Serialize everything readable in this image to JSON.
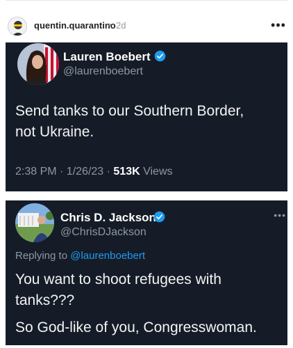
{
  "post": {
    "author": "quentin.quarantino",
    "separator": "•",
    "age": "2d",
    "more_menu": "•••"
  },
  "tweets": [
    {
      "display_name": "Lauren Boebert",
      "handle": "@laurenboebert",
      "text_lines": [
        "Send tanks to our Southern Border,",
        "not Ukraine."
      ],
      "time": "2:38 PM · 1/26/23 · ",
      "views_count": "513K",
      "views_label": " Views"
    },
    {
      "display_name": "Chris D. Jackson",
      "handle": "@ChrisDJackson",
      "replying_prefix": "Replying to ",
      "replying_to": "@laurenboebert",
      "text_lines": [
        "You want to shoot refugees with",
        "tanks???"
      ],
      "text_line_3": "So God-like of you, Congresswoman.",
      "menu": "•••"
    }
  ],
  "colors": {
    "tweet_bg": "#161c27",
    "verified": "#1d9bf0",
    "secondary_text": "#8b98a5",
    "mention": "#1d9bf0"
  }
}
